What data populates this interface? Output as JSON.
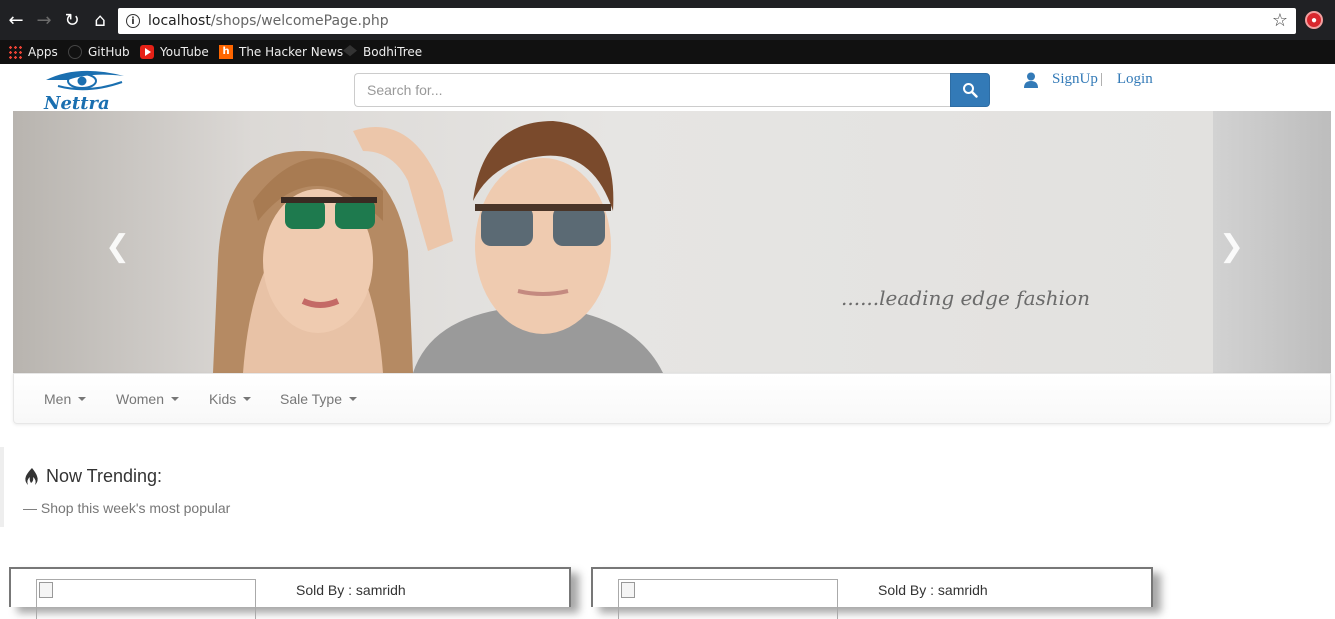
{
  "browser": {
    "url_host": "localhost",
    "url_path": "/shops/welcomePage.php",
    "bookmarks": [
      {
        "label": "Apps",
        "icon": "apps-icon"
      },
      {
        "label": "GitHub",
        "icon": "github-icon"
      },
      {
        "label": "YouTube",
        "icon": "youtube-icon"
      },
      {
        "label": "The Hacker News",
        "icon": "hacker-news-icon"
      },
      {
        "label": "BodhiTree",
        "icon": "bodhitree-icon"
      }
    ]
  },
  "header": {
    "logo_text": "Nettra",
    "search_placeholder": "Search for...",
    "signup_label": "SignUp",
    "separator": "|",
    "login_label": "Login"
  },
  "carousel": {
    "caption": "......leading edge fashion"
  },
  "categories": [
    {
      "label": "Men"
    },
    {
      "label": "Women"
    },
    {
      "label": "Kids"
    },
    {
      "label": "Sale Type"
    }
  ],
  "trending": {
    "title": "Now Trending:",
    "subtitle": "— Shop this week's most popular"
  },
  "products": [
    {
      "sold_by": "Sold By : samridh"
    },
    {
      "sold_by": "Sold By : samridh"
    }
  ],
  "colors": {
    "brand_blue": "#337ab7",
    "logo_blue": "#1a6fb0"
  }
}
